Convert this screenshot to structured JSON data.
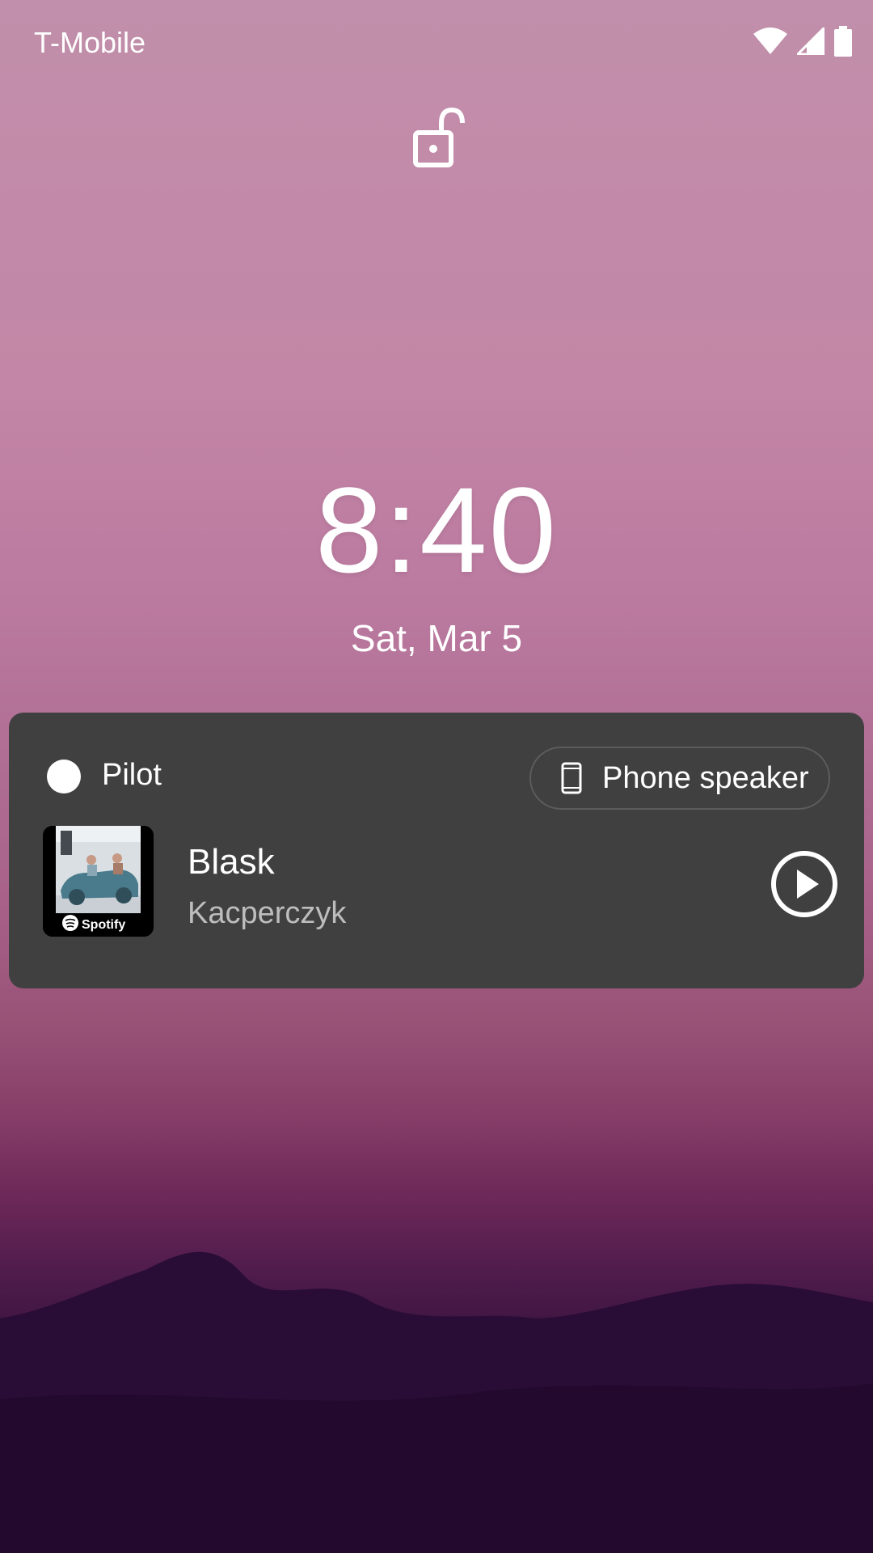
{
  "status_bar": {
    "carrier": "T-Mobile",
    "icons": [
      "wifi-icon",
      "cellular-signal-icon",
      "battery-icon"
    ]
  },
  "lockscreen": {
    "lock_icon": "unlocked-padlock-icon",
    "time": "8:40",
    "date": "Sat, Mar 5"
  },
  "media": {
    "app_name": "Pilot",
    "output_device_label": "Phone speaker",
    "output_device_icon": "phone-icon",
    "track_title": "Blask",
    "track_artist": "Kacperczyk",
    "album_art_badge": "Spotify",
    "play_icon": "play-icon",
    "card_color": "#404040"
  }
}
